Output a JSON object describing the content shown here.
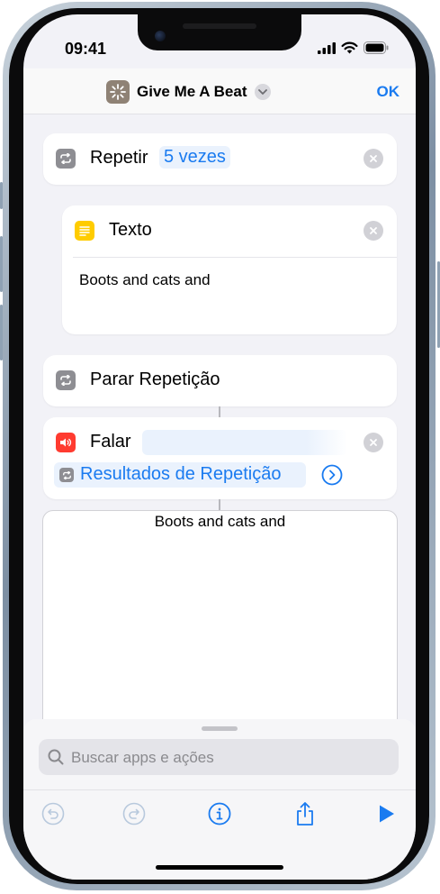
{
  "status_bar": {
    "time": "09:41"
  },
  "header": {
    "title": "Give Me A Beat",
    "ok_label": "OK"
  },
  "actions": {
    "repeat": {
      "label": "Repetir",
      "count_token": "5 vezes"
    },
    "text": {
      "label": "Texto",
      "content": "Boots and cats and"
    },
    "end_repeat": {
      "label": "Parar Repetição"
    },
    "speak": {
      "label": "Falar",
      "variable_token": "Resultados de Repetição"
    }
  },
  "output_preview": {
    "text": "Boots and cats and"
  },
  "bottom_sheet": {
    "search_placeholder": "Buscar apps e ações"
  },
  "colors": {
    "accent": "#1a7bf0",
    "repeat_icon": "#8e8e93",
    "text_icon": "#ffcc00",
    "speak_icon": "#ff3b30",
    "app_icon": "#8f8275"
  },
  "icons": [
    "repeat-icon",
    "text-icon",
    "speaker-icon",
    "search-icon",
    "undo-icon",
    "redo-icon",
    "info-icon",
    "share-icon",
    "play-icon"
  ]
}
